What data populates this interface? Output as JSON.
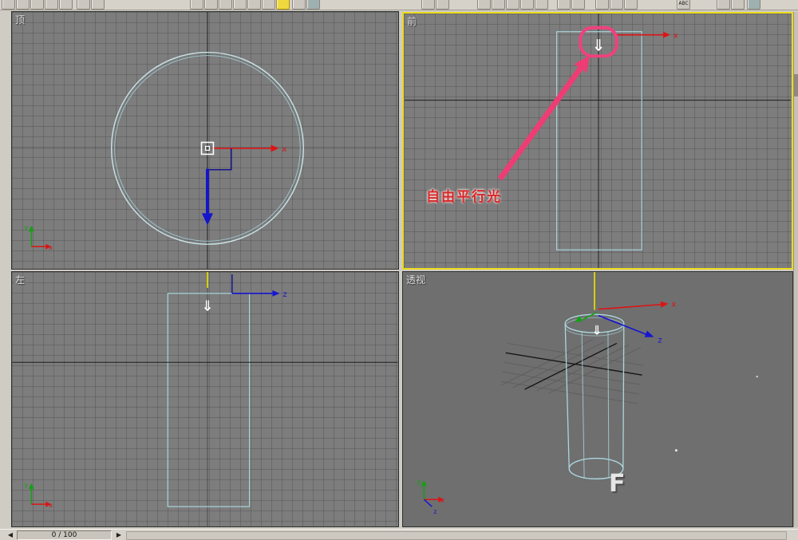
{
  "toolbar": {
    "abc_label": "ABC"
  },
  "viewports": {
    "top": {
      "label": "顶"
    },
    "front": {
      "label": "前"
    },
    "left": {
      "label": "左"
    },
    "perspective": {
      "label": "透视"
    }
  },
  "annotation": {
    "label": "自由平行光"
  },
  "axes": {
    "x": "x",
    "y": "y",
    "z": "z"
  },
  "icons": {
    "light_glyph": "⇓",
    "prev_glyph": "◀",
    "next_glyph": "▶"
  },
  "watermark": "F",
  "timeline": {
    "frame_display": "0 / 100"
  },
  "colors": {
    "active_viewport_border": "#ecda1e",
    "annotation_pink": "#ee3d74",
    "annotation_text_red": "#d62828",
    "wireframe_cyan": "#a6ced6",
    "axis_x_red": "#dc1414",
    "axis_y_green": "#14a014",
    "axis_z_blue": "#1616d2"
  }
}
